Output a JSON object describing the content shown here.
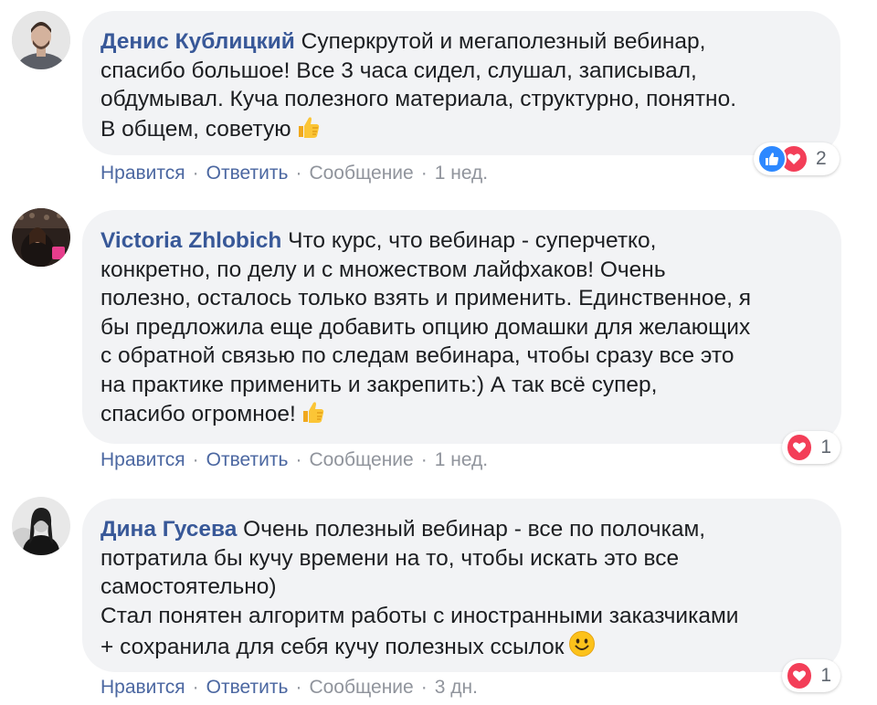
{
  "comments": [
    {
      "author": "Денис Кублицкий",
      "text": "Суперкрутой и мегаполезный вебинар,\nспасибо большое! Все 3 часа сидел, слушал, записывал,\nобдумывал. Куча полезного материала, структурно, понятно.\nВ общем, советую",
      "emoji": "thumbs-up-emoji",
      "actions": {
        "like": "Нравится",
        "reply": "Ответить",
        "message": "Сообщение",
        "time": "1 нед."
      },
      "reactions": {
        "types": [
          "like",
          "love"
        ],
        "count": "2"
      }
    },
    {
      "author": "Victoria Zhlobich",
      "text": "Что курс, что вебинар - суперчетко,\nконкретно, по делу и с множеством лайфхаков! Очень\nполезно, осталось только взять и применить. Единственное, я\nбы предложила еще добавить опцию домашки для желающих\nс обратной связью по следам вебинара, чтобы сразу все это\nна практике применить и закрепить:) А так всё супер,\nспасибо огромное!",
      "emoji": "thumbs-up-emoji",
      "actions": {
        "like": "Нравится",
        "reply": "Ответить",
        "message": "Сообщение",
        "time": "1 нед."
      },
      "reactions": {
        "types": [
          "love"
        ],
        "count": "1"
      }
    },
    {
      "author": "Дина Гусева",
      "text": "Очень полезный вебинар - все по полочкам,\nпотратила бы кучу времени на то, чтобы искать это все\nсамостоятельно)\nСтал понятен алгоритм работы с иностранными заказчиками\n+ сохранила для себя кучу полезных ссылок",
      "emoji": "smiley-emoji",
      "actions": {
        "like": "Нравится",
        "reply": "Ответить",
        "message": "Сообщение",
        "time": "3 дн."
      },
      "reactions": {
        "types": [
          "love"
        ],
        "count": "1"
      }
    }
  ],
  "colors": {
    "author": "#385898",
    "action_link": "#4b67a1",
    "muted": "#90949c",
    "bubble": "#f2f3f5",
    "like": "#2d88ff",
    "love": "#f33e58"
  }
}
